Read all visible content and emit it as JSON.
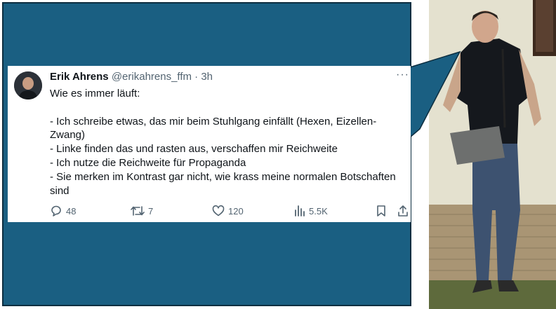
{
  "tweet": {
    "author_name": "Erik Ahrens",
    "handle": "@erikahrens_ffm",
    "separator": "·",
    "time": "3h",
    "more_icon": "more-icon",
    "lines": [
      "Wie es immer läuft:",
      "",
      "- Ich schreibe etwas, das mir beim Stuhlgang einfällt (Hexen, Eizellen-",
      "Zwang)",
      "- Linke finden das und rasten aus, verschaffen mir Reichweite",
      "- Ich nutze die Reichweite für Propaganda",
      "- Sie merken im Kontrast gar nicht, wie krass meine normalen Botschaften",
      "sind"
    ],
    "actions": {
      "replies": "48",
      "reposts": "7",
      "likes": "120",
      "views": "5.5K"
    }
  },
  "colors": {
    "panel": "#1a5f82",
    "panel_border": "#0d2e40",
    "text": "#0f1419",
    "muted": "#536471"
  }
}
